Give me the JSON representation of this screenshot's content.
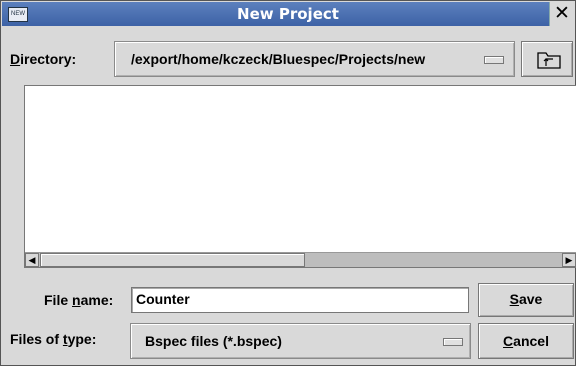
{
  "window": {
    "title": "New Project",
    "app_icon_text": "NEW",
    "close_glyph": "✕"
  },
  "directory": {
    "label_first": "D",
    "label_rest": "irectory:",
    "value": "/export/home/kczeck/Bluespec/Projects/new"
  },
  "file_name": {
    "label_pre": "File ",
    "label_u": "n",
    "label_post": "ame:",
    "value": "Counter"
  },
  "file_type": {
    "label_pre": "Files of ",
    "label_u": "t",
    "label_post": "ype:",
    "value": "Bspec files (*.bspec)"
  },
  "buttons": {
    "save_u": "S",
    "save_rest": "ave",
    "cancel_u": "C",
    "cancel_rest": "ancel"
  },
  "scrollbar": {
    "left_arrow": "◀",
    "right_arrow": "▶"
  },
  "files": []
}
